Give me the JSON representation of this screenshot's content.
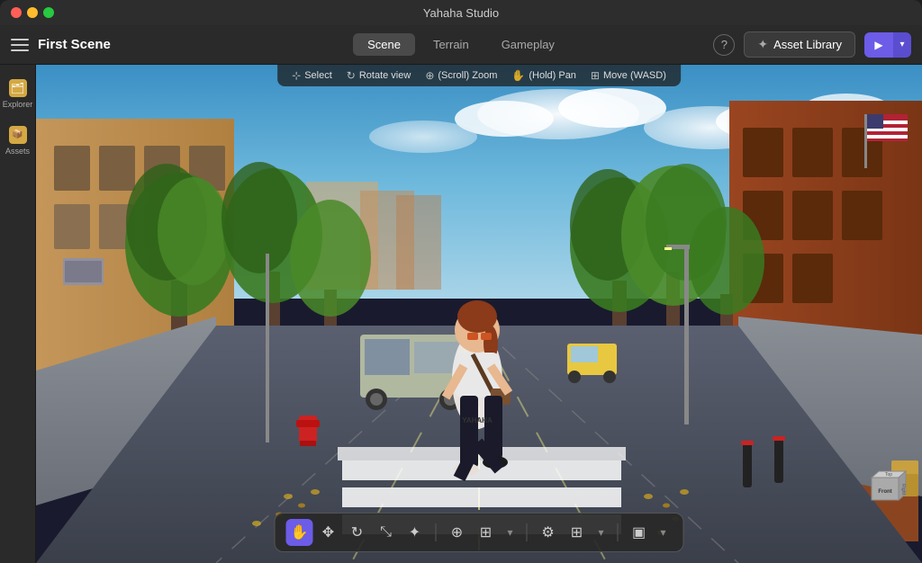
{
  "app": {
    "title": "Yahaha Studio",
    "window_title": "Yahaha Studio"
  },
  "toolbar": {
    "menu_label": "menu",
    "scene_title": "First Scene",
    "tabs": [
      {
        "id": "scene",
        "label": "Scene",
        "active": true
      },
      {
        "id": "terrain",
        "label": "Terrain",
        "active": false
      },
      {
        "id": "gameplay",
        "label": "Gameplay",
        "active": false
      }
    ],
    "help_label": "?",
    "asset_library_label": "Asset Library",
    "play_label": "▶",
    "play_dropdown_label": "▾"
  },
  "sidebar": {
    "items": [
      {
        "id": "explorer",
        "label": "Explorer",
        "icon": "🗂"
      },
      {
        "id": "assets",
        "label": "Assets",
        "icon": "📦"
      }
    ]
  },
  "viewport": {
    "tool_hints": [
      {
        "id": "select",
        "icon": "⊹",
        "label": "Select"
      },
      {
        "id": "rotate",
        "icon": "↻",
        "label": "Rotate view"
      },
      {
        "id": "zoom",
        "icon": "⊕",
        "label": "(Scroll) Zoom"
      },
      {
        "id": "pan",
        "icon": "✋",
        "label": "(Hold) Pan"
      },
      {
        "id": "move",
        "icon": "⊞",
        "label": "Move (WASD)"
      }
    ]
  },
  "bottom_toolbar": {
    "groups": [
      {
        "id": "main-tools",
        "buttons": [
          {
            "id": "hand",
            "icon": "✋",
            "active": true,
            "label": "Hand tool"
          },
          {
            "id": "move",
            "icon": "✥",
            "active": false,
            "label": "Move tool"
          },
          {
            "id": "rotate",
            "icon": "↻",
            "active": false,
            "label": "Rotate tool"
          },
          {
            "id": "scale",
            "icon": "⊡",
            "active": false,
            "label": "Scale tool"
          },
          {
            "id": "transform",
            "icon": "⊹",
            "active": false,
            "label": "Transform tool"
          }
        ]
      },
      {
        "id": "object-tools",
        "buttons": [
          {
            "id": "obj1",
            "icon": "⊕",
            "active": false,
            "label": "Object tool 1"
          },
          {
            "id": "obj2",
            "icon": "⊞",
            "active": false,
            "label": "Object tool 2"
          }
        ]
      }
    ],
    "right_buttons": [
      {
        "id": "settings",
        "icon": "⚙",
        "label": "Settings"
      },
      {
        "id": "grid",
        "icon": "⊞",
        "label": "Grid"
      },
      {
        "id": "expand1",
        "icon": "▾",
        "label": "Expand 1"
      },
      {
        "id": "camera",
        "icon": "⊡",
        "label": "Camera"
      },
      {
        "id": "expand2",
        "icon": "▾",
        "label": "Expand 2"
      }
    ]
  },
  "orient_cube": {
    "front_label": "Front",
    "right_label": "Right"
  },
  "colors": {
    "accent": "#6c5ce7",
    "sidebar_bg": "#2a2a2a",
    "toolbar_bg": "#2a2a2a",
    "asset_btn_bg": "#3a3a3a"
  }
}
